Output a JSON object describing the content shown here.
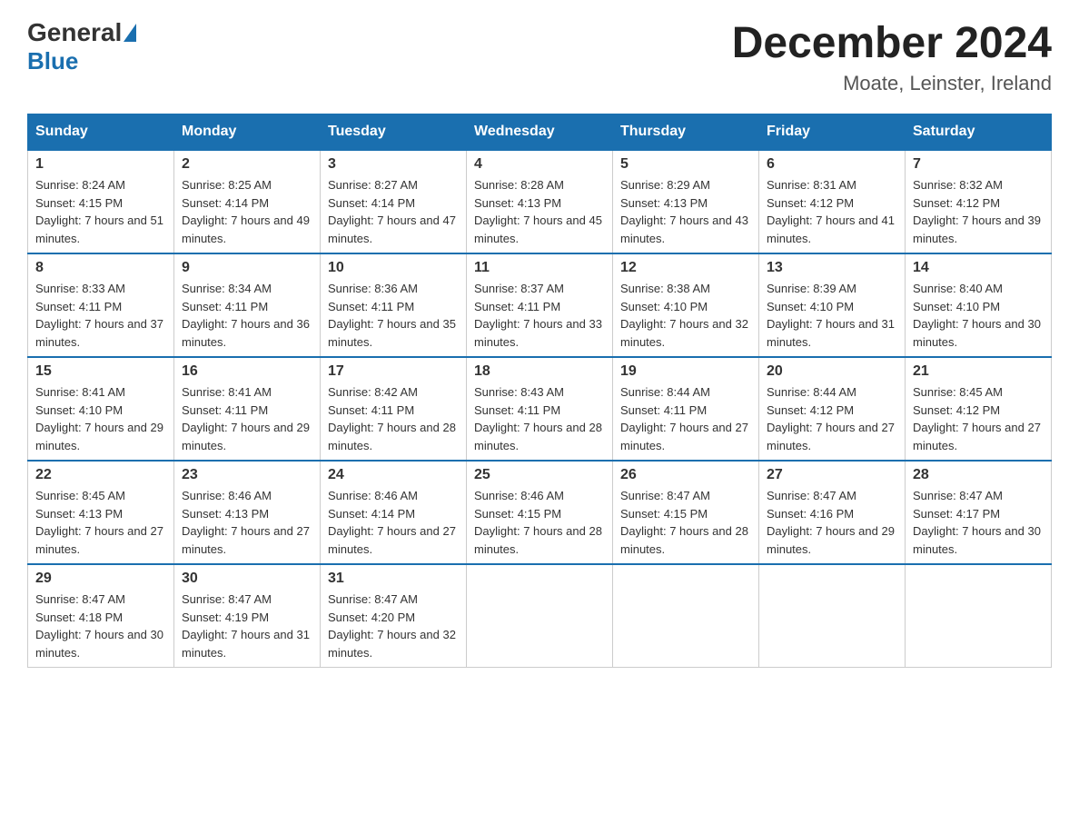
{
  "logo": {
    "text_general": "General",
    "triangle": "▶",
    "text_blue": "Blue"
  },
  "title": "December 2024",
  "location": "Moate, Leinster, Ireland",
  "days_of_week": [
    "Sunday",
    "Monday",
    "Tuesday",
    "Wednesday",
    "Thursday",
    "Friday",
    "Saturday"
  ],
  "weeks": [
    [
      {
        "day": "1",
        "sunrise": "8:24 AM",
        "sunset": "4:15 PM",
        "daylight": "7 hours and 51 minutes."
      },
      {
        "day": "2",
        "sunrise": "8:25 AM",
        "sunset": "4:14 PM",
        "daylight": "7 hours and 49 minutes."
      },
      {
        "day": "3",
        "sunrise": "8:27 AM",
        "sunset": "4:14 PM",
        "daylight": "7 hours and 47 minutes."
      },
      {
        "day": "4",
        "sunrise": "8:28 AM",
        "sunset": "4:13 PM",
        "daylight": "7 hours and 45 minutes."
      },
      {
        "day": "5",
        "sunrise": "8:29 AM",
        "sunset": "4:13 PM",
        "daylight": "7 hours and 43 minutes."
      },
      {
        "day": "6",
        "sunrise": "8:31 AM",
        "sunset": "4:12 PM",
        "daylight": "7 hours and 41 minutes."
      },
      {
        "day": "7",
        "sunrise": "8:32 AM",
        "sunset": "4:12 PM",
        "daylight": "7 hours and 39 minutes."
      }
    ],
    [
      {
        "day": "8",
        "sunrise": "8:33 AM",
        "sunset": "4:11 PM",
        "daylight": "7 hours and 37 minutes."
      },
      {
        "day": "9",
        "sunrise": "8:34 AM",
        "sunset": "4:11 PM",
        "daylight": "7 hours and 36 minutes."
      },
      {
        "day": "10",
        "sunrise": "8:36 AM",
        "sunset": "4:11 PM",
        "daylight": "7 hours and 35 minutes."
      },
      {
        "day": "11",
        "sunrise": "8:37 AM",
        "sunset": "4:11 PM",
        "daylight": "7 hours and 33 minutes."
      },
      {
        "day": "12",
        "sunrise": "8:38 AM",
        "sunset": "4:10 PM",
        "daylight": "7 hours and 32 minutes."
      },
      {
        "day": "13",
        "sunrise": "8:39 AM",
        "sunset": "4:10 PM",
        "daylight": "7 hours and 31 minutes."
      },
      {
        "day": "14",
        "sunrise": "8:40 AM",
        "sunset": "4:10 PM",
        "daylight": "7 hours and 30 minutes."
      }
    ],
    [
      {
        "day": "15",
        "sunrise": "8:41 AM",
        "sunset": "4:10 PM",
        "daylight": "7 hours and 29 minutes."
      },
      {
        "day": "16",
        "sunrise": "8:41 AM",
        "sunset": "4:11 PM",
        "daylight": "7 hours and 29 minutes."
      },
      {
        "day": "17",
        "sunrise": "8:42 AM",
        "sunset": "4:11 PM",
        "daylight": "7 hours and 28 minutes."
      },
      {
        "day": "18",
        "sunrise": "8:43 AM",
        "sunset": "4:11 PM",
        "daylight": "7 hours and 28 minutes."
      },
      {
        "day": "19",
        "sunrise": "8:44 AM",
        "sunset": "4:11 PM",
        "daylight": "7 hours and 27 minutes."
      },
      {
        "day": "20",
        "sunrise": "8:44 AM",
        "sunset": "4:12 PM",
        "daylight": "7 hours and 27 minutes."
      },
      {
        "day": "21",
        "sunrise": "8:45 AM",
        "sunset": "4:12 PM",
        "daylight": "7 hours and 27 minutes."
      }
    ],
    [
      {
        "day": "22",
        "sunrise": "8:45 AM",
        "sunset": "4:13 PM",
        "daylight": "7 hours and 27 minutes."
      },
      {
        "day": "23",
        "sunrise": "8:46 AM",
        "sunset": "4:13 PM",
        "daylight": "7 hours and 27 minutes."
      },
      {
        "day": "24",
        "sunrise": "8:46 AM",
        "sunset": "4:14 PM",
        "daylight": "7 hours and 27 minutes."
      },
      {
        "day": "25",
        "sunrise": "8:46 AM",
        "sunset": "4:15 PM",
        "daylight": "7 hours and 28 minutes."
      },
      {
        "day": "26",
        "sunrise": "8:47 AM",
        "sunset": "4:15 PM",
        "daylight": "7 hours and 28 minutes."
      },
      {
        "day": "27",
        "sunrise": "8:47 AM",
        "sunset": "4:16 PM",
        "daylight": "7 hours and 29 minutes."
      },
      {
        "day": "28",
        "sunrise": "8:47 AM",
        "sunset": "4:17 PM",
        "daylight": "7 hours and 30 minutes."
      }
    ],
    [
      {
        "day": "29",
        "sunrise": "8:47 AM",
        "sunset": "4:18 PM",
        "daylight": "7 hours and 30 minutes."
      },
      {
        "day": "30",
        "sunrise": "8:47 AM",
        "sunset": "4:19 PM",
        "daylight": "7 hours and 31 minutes."
      },
      {
        "day": "31",
        "sunrise": "8:47 AM",
        "sunset": "4:20 PM",
        "daylight": "7 hours and 32 minutes."
      },
      null,
      null,
      null,
      null
    ]
  ]
}
